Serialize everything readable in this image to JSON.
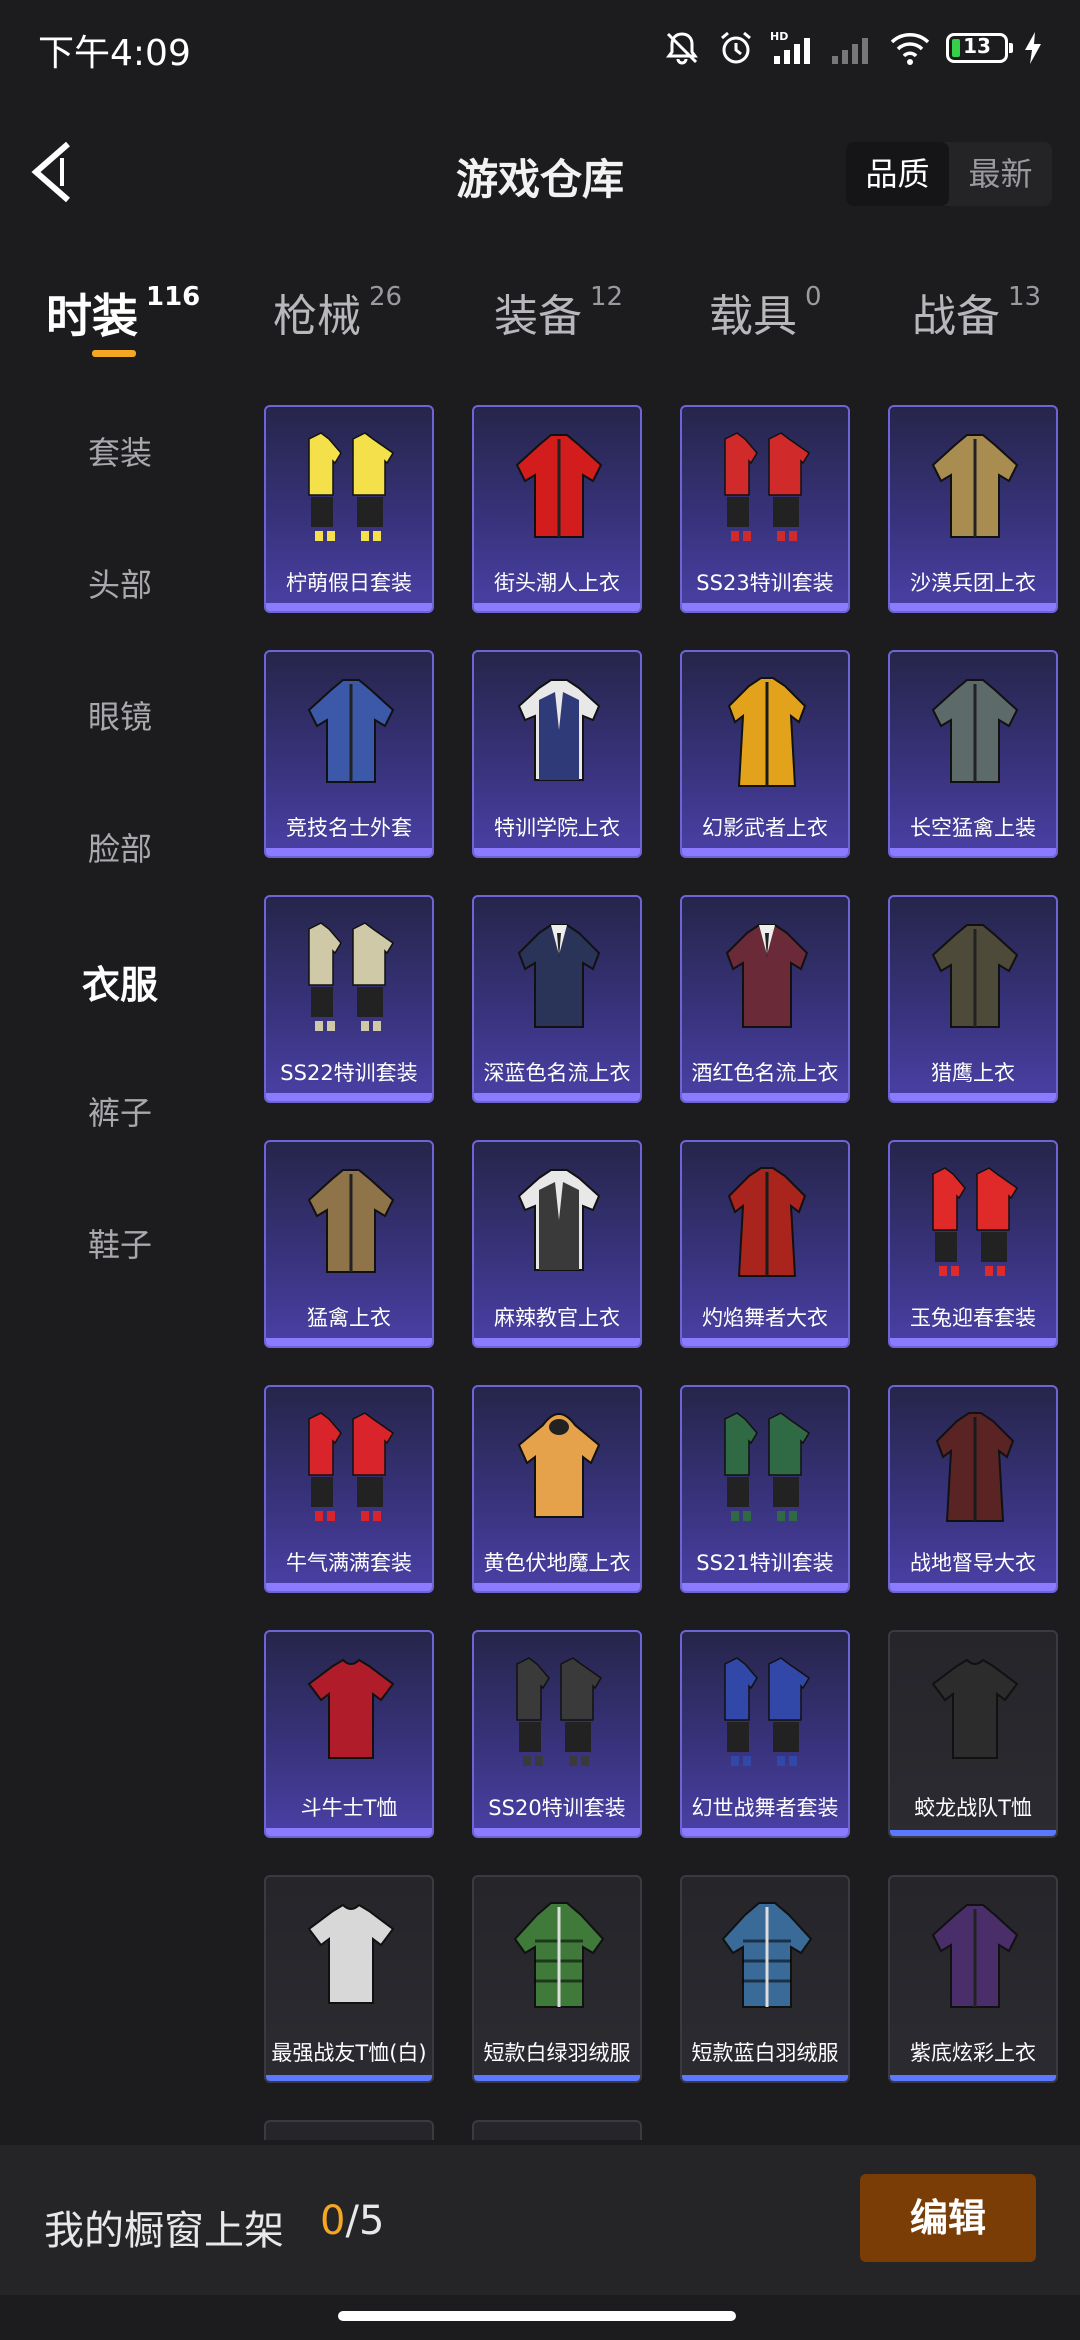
{
  "status_bar": {
    "time": "下午4:09",
    "battery": "13",
    "icons": [
      "mute-bell-icon",
      "alarm-icon",
      "hd-signal-icon",
      "signal-weak-icon",
      "wifi-icon",
      "battery-icon",
      "charging-icon"
    ],
    "hd_label": "HD"
  },
  "header": {
    "title": "游戏仓库",
    "sort_options": [
      "品质",
      "最新"
    ],
    "sort_selected": "品质"
  },
  "category_tabs": [
    {
      "label": "时装",
      "count": "116",
      "active": true
    },
    {
      "label": "枪械",
      "count": "26",
      "active": false
    },
    {
      "label": "装备",
      "count": "12",
      "active": false
    },
    {
      "label": "载具",
      "count": "0",
      "active": false
    },
    {
      "label": "战备",
      "count": "13",
      "active": false
    }
  ],
  "sidebar": {
    "items": [
      "套装",
      "头部",
      "眼镜",
      "脸部",
      "衣服",
      "裤子",
      "鞋子"
    ],
    "active": "衣服"
  },
  "items": [
    {
      "name": "柠萌假日套装",
      "icon": "outfit-set-icon",
      "color": "#f3e04a",
      "tier": "purple"
    },
    {
      "name": "街头潮人上衣",
      "icon": "jacket-icon",
      "color": "#d31c1c",
      "tier": "purple"
    },
    {
      "name": "SS23特训套装",
      "icon": "outfit-set-icon",
      "color": "#d12a2a",
      "tier": "purple"
    },
    {
      "name": "沙漠兵团上衣",
      "icon": "jacket-icon",
      "color": "#a88c50",
      "tier": "purple"
    },
    {
      "name": "竞技名士外套",
      "icon": "jacket-icon",
      "color": "#3c58a8",
      "tier": "purple"
    },
    {
      "name": "特训学院上衣",
      "icon": "vest-icon",
      "color": "#2f3a78",
      "tier": "purple"
    },
    {
      "name": "幻影武者上衣",
      "icon": "coat-icon",
      "color": "#e3a21c",
      "tier": "purple"
    },
    {
      "name": "长空猛禽上装",
      "icon": "jacket-icon",
      "color": "#5d6a6a",
      "tier": "purple"
    },
    {
      "name": "SS22特训套装",
      "icon": "outfit-set-icon",
      "color": "#cfc9a8",
      "tier": "purple"
    },
    {
      "name": "深蓝色名流上衣",
      "icon": "suit-icon",
      "color": "#2a3358",
      "tier": "purple"
    },
    {
      "name": "酒红色名流上衣",
      "icon": "suit-icon",
      "color": "#6a2a38",
      "tier": "purple"
    },
    {
      "name": "猎鹰上衣",
      "icon": "jacket-icon",
      "color": "#4e4a3a",
      "tier": "purple"
    },
    {
      "name": "猛禽上衣",
      "icon": "jacket-icon",
      "color": "#8e7448",
      "tier": "purple"
    },
    {
      "name": "麻辣教官上衣",
      "icon": "vest-icon",
      "color": "#3a3a3a",
      "tier": "purple"
    },
    {
      "name": "灼焰舞者大衣",
      "icon": "coat-icon",
      "color": "#a8241c",
      "tier": "purple"
    },
    {
      "name": "玉兔迎春套装",
      "icon": "outfit-set-icon",
      "color": "#e02a2a",
      "tier": "purple"
    },
    {
      "name": "牛气满满套装",
      "icon": "outfit-set-icon",
      "color": "#d8242a",
      "tier": "purple"
    },
    {
      "name": "黄色伏地魔上衣",
      "icon": "hoodie-icon",
      "color": "#e6a24a",
      "tier": "purple"
    },
    {
      "name": "SS21特训套装",
      "icon": "outfit-set-icon",
      "color": "#2f6a44",
      "tier": "purple"
    },
    {
      "name": "战地督导大衣",
      "icon": "coat-icon",
      "color": "#5a2424",
      "tier": "purple"
    },
    {
      "name": "斗牛士T恤",
      "icon": "tshirt-icon",
      "color": "#b01c2a",
      "tier": "purple"
    },
    {
      "name": "SS20特训套装",
      "icon": "outfit-set-icon",
      "color": "#3a3a3a",
      "tier": "purple"
    },
    {
      "name": "幻世战舞者套装",
      "icon": "outfit-set-icon",
      "color": "#3248a8",
      "tier": "purple"
    },
    {
      "name": "蛟龙战队T恤",
      "icon": "tshirt-icon",
      "color": "#2c2c2c",
      "tier": "blue"
    },
    {
      "name": "最强战友T恤(白)",
      "icon": "tshirt-icon",
      "color": "#d8d8d8",
      "tier": "blue"
    },
    {
      "name": "短款白绿羽绒服",
      "icon": "puffer-jacket-icon",
      "color": "#3f7a3a",
      "tier": "blue"
    },
    {
      "name": "短款蓝白羽绒服",
      "icon": "puffer-jacket-icon",
      "color": "#3a6a98",
      "tier": "blue"
    },
    {
      "name": "紫底炫彩上衣",
      "icon": "jacket-icon",
      "color": "#4a2e6a",
      "tier": "blue"
    }
  ],
  "bottom_bar": {
    "label": "我的橱窗上架",
    "current": "0",
    "separator": "/",
    "total": "5",
    "edit_label": "编辑"
  }
}
